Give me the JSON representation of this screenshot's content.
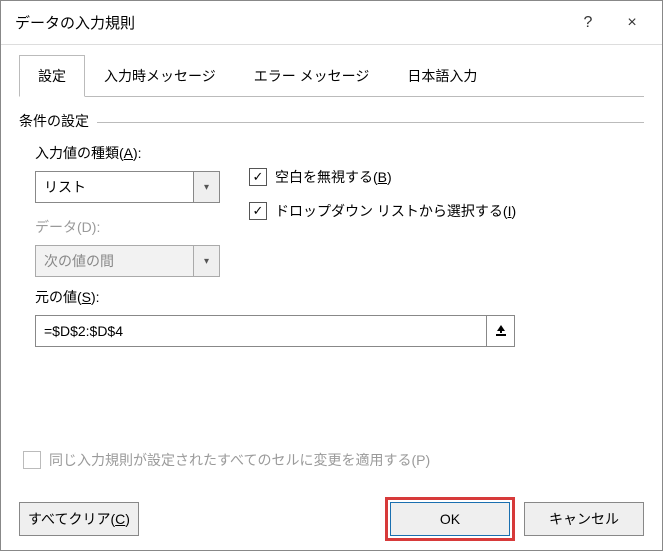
{
  "title": "データの入力規則",
  "titlebar": {
    "help": "?",
    "close": "×"
  },
  "tabs": [
    "設定",
    "入力時メッセージ",
    "エラー メッセージ",
    "日本語入力"
  ],
  "group": "条件の設定",
  "allow": {
    "label_pre": "入力値の種類(",
    "label_key": "A",
    "label_post": "):",
    "value": "リスト"
  },
  "data": {
    "label_pre": "データ(",
    "label_key": "D",
    "label_post": "):",
    "value": "次の値の間"
  },
  "ignore_blank": {
    "label_pre": "空白を無視する(",
    "label_key": "B",
    "label_post": ")"
  },
  "dropdown": {
    "label_pre": "ドロップダウン リストから選択する(",
    "label_key": "I",
    "label_post": ")"
  },
  "source": {
    "label_pre": "元の値(",
    "label_key": "S",
    "label_post": "):",
    "value": "=$D$2:$D$4"
  },
  "apply": {
    "label_pre": "同じ入力規則が設定されたすべてのセルに変更を適用する(",
    "label_key": "P",
    "label_post": ")"
  },
  "footer": {
    "clear_pre": "すべてクリア(",
    "clear_key": "C",
    "clear_post": ")",
    "ok": "OK",
    "cancel": "キャンセル"
  }
}
